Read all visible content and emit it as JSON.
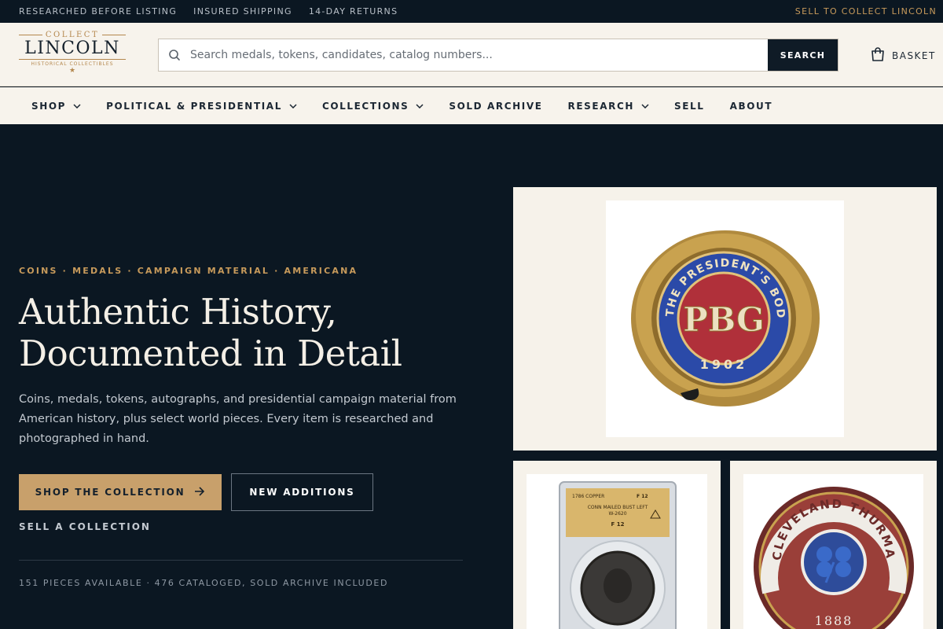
{
  "topbar": {
    "perks": [
      "RESEARCHED BEFORE LISTING",
      "INSURED SHIPPING",
      "14-DAY RETURNS"
    ],
    "sell_link": "SELL TO COLLECT LINCOLN"
  },
  "header": {
    "logo": {
      "top": "COLLECT",
      "main": "LINCOLN",
      "sub": "HISTORICAL COLLECTIBLES"
    },
    "search": {
      "placeholder": "Search medals, tokens, candidates, catalog numbers...",
      "button": "SEARCH",
      "icon": "search-icon"
    },
    "basket": {
      "label": "BASKET",
      "icon": "basket-icon"
    }
  },
  "nav": {
    "items": [
      {
        "label": "SHOP",
        "dropdown": true
      },
      {
        "label": "POLITICAL & PRESIDENTIAL",
        "dropdown": true
      },
      {
        "label": "COLLECTIONS",
        "dropdown": true
      },
      {
        "label": "SOLD ARCHIVE",
        "dropdown": false
      },
      {
        "label": "RESEARCH",
        "dropdown": true
      },
      {
        "label": "SELL",
        "dropdown": false
      },
      {
        "label": "ABOUT",
        "dropdown": false
      }
    ]
  },
  "hero": {
    "eyebrow": "COINS · MEDALS · CAMPAIGN MATERIAL · AMERICANA",
    "headline_lines": [
      "Authentic History,",
      "Documented in Detail"
    ],
    "lede": "Coins, medals, tokens, autographs, and presidential campaign material from American history, plus select world pieces. Every item is researched and photographed in hand.",
    "primary_cta": "SHOP THE COLLECTION",
    "secondary_cta": "NEW ADDITIONS",
    "tertiary_link": "SELL A COLLECTION",
    "stats": "151 PIECES AVAILABLE · 476 CATALOGED, SOLD ARCHIVE INCLUDED"
  },
  "gallery": {
    "main": {
      "ring_text": "THE PRESIDENT'S BODY GUARD",
      "year": "1902",
      "monogram": "PBG"
    },
    "slab": {
      "label_line1": "1786 COPPER",
      "label_grade": "F 12",
      "label_line2": "CONN MAILED BUST LEFT",
      "label_line3": "W-2620",
      "label_line4": "F 12"
    },
    "pin": {
      "ring_text": "CLEVELAND THURMAN",
      "year": "1888"
    }
  },
  "colors": {
    "bg_dark": "#0b1722",
    "cream": "#f7f3ec",
    "gold": "#c79a5b",
    "cta": "#c8a06b"
  }
}
